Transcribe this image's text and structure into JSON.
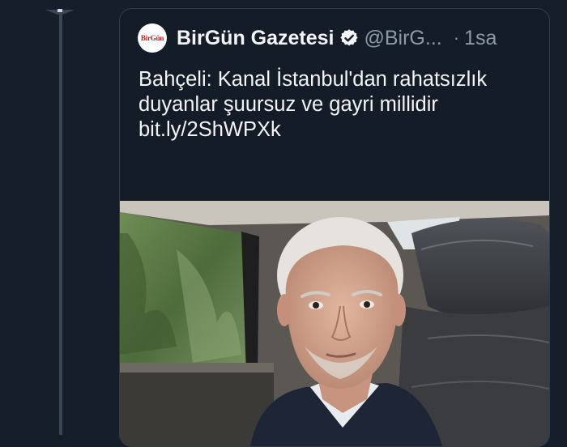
{
  "tweet": {
    "account_name": "BirGün Gazetesi",
    "avatar_text": "BirGün",
    "verified_icon": "verified-badge-icon",
    "handle": "@BirG...",
    "separator": "·",
    "time": "1sa",
    "text": "Bahçeli: Kanal İstanbul'dan rahatsızlık duyanlar şuursuz ve gayri millidir",
    "link": "bit.ly/2ShWPXk",
    "image_alt": "photo"
  },
  "colors": {
    "background": "#161e2a",
    "text": "#f3f5f7",
    "secondary_text": "#8c99a8",
    "card_border": "#303c4d",
    "thread_line": "#3a4658",
    "brand_red": "#c8191e"
  }
}
